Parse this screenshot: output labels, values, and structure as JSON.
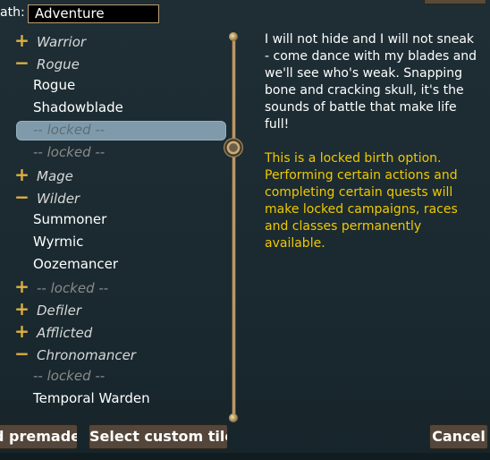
{
  "path": {
    "label": "ath:",
    "value": "Adventure"
  },
  "tree": [
    {
      "type": "cat",
      "sign": "+",
      "label": "Warrior"
    },
    {
      "type": "cat",
      "sign": "−",
      "label": "Rogue"
    },
    {
      "type": "sub",
      "label": "Rogue"
    },
    {
      "type": "sub",
      "label": "Shadowblade"
    },
    {
      "type": "sub",
      "label": "-- locked --",
      "locked": true,
      "selected": true
    },
    {
      "type": "sub",
      "label": "-- locked --",
      "locked": true
    },
    {
      "type": "cat",
      "sign": "+",
      "label": "Mage"
    },
    {
      "type": "cat",
      "sign": "−",
      "label": "Wilder"
    },
    {
      "type": "sub",
      "label": "Summoner"
    },
    {
      "type": "sub",
      "label": "Wyrmic"
    },
    {
      "type": "sub",
      "label": "Oozemancer"
    },
    {
      "type": "cat",
      "sign": "+",
      "label": "-- locked --",
      "locked": true
    },
    {
      "type": "cat",
      "sign": "+",
      "label": "Defiler"
    },
    {
      "type": "cat",
      "sign": "+",
      "label": "Afflicted"
    },
    {
      "type": "cat",
      "sign": "−",
      "label": "Chronomancer"
    },
    {
      "type": "sub",
      "label": "-- locked --",
      "locked": true
    },
    {
      "type": "sub",
      "label": "Temporal Warden"
    }
  ],
  "description": "I will not hide and I will not sneak - come dance with my blades and we'll see who's weak. Snapping bone and cracking skull, it's the sounds of battle that make life full!",
  "locked_note": "This is a locked birth option. Performing certain actions and completing certain quests will make locked campaigns, races and classes permanently available.",
  "buttons": {
    "premade": "d premade",
    "custom_tile": "Select custom tile",
    "cancel": "Cancel"
  },
  "colors": {
    "background": "#1b2a30",
    "accent_gold": "#e0b040",
    "locked_note": "#f0c800",
    "selection": "#7f9bab",
    "button": "#54463a"
  }
}
